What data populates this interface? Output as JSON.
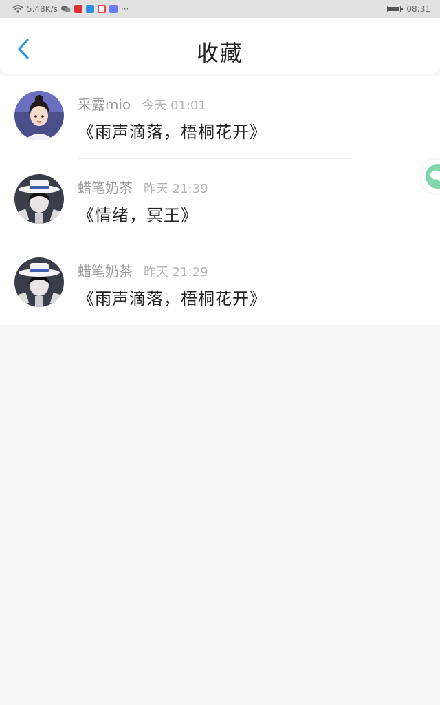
{
  "status_bar": {
    "net_speed": "5.48K/s",
    "clock": "08:31",
    "icons": [
      "wifi-icon",
      "wechat-icon",
      "app-red-icon",
      "app-blue-icon",
      "app-red-square-icon",
      "app-purple-icon",
      "more-icon",
      "battery-icon"
    ]
  },
  "header": {
    "title": "收藏",
    "back_icon": "chevron-left-icon",
    "back_color": "#2c9be6"
  },
  "favorites": [
    {
      "author": "采露mio",
      "time": "今天 01:01",
      "title": "《雨声滴落，梧桐花开》"
    },
    {
      "author": "蜡笔奶茶",
      "time": "昨天 21:39",
      "title": "《情绪，冥王》"
    },
    {
      "author": "蜡笔奶茶",
      "time": "昨天 21:29",
      "title": "《雨声滴落，梧桐花开》"
    }
  ],
  "float_tab": {
    "icon": "chat-bubble-icon",
    "color": "#7fd6a8"
  }
}
